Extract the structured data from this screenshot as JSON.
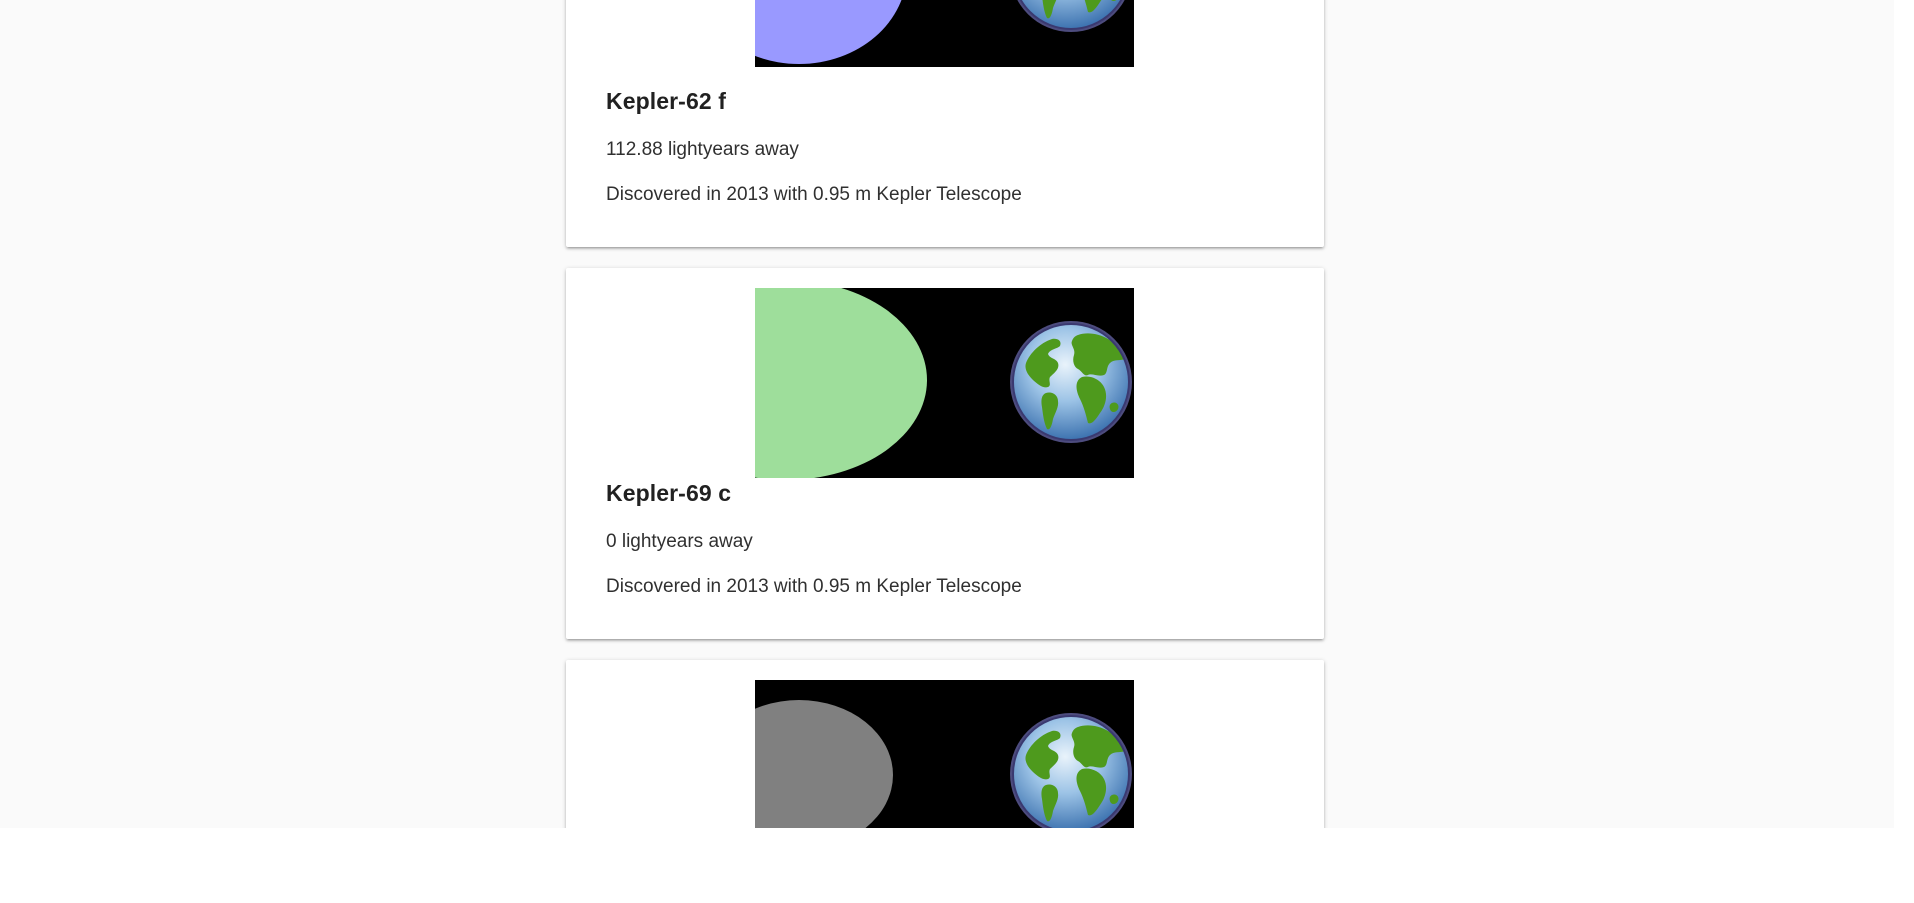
{
  "planets": [
    {
      "name": "Kepler-62 f",
      "distance_text": "112.88 lightyears away",
      "discovery_text": "Discovered in 2013 with 0.95 m Kepler Telescope",
      "color": "#9999ff",
      "comparison_icon": "earth-icon"
    },
    {
      "name": "Kepler-69 c",
      "distance_text": "0 lightyears away",
      "discovery_text": "Discovered in 2013 with 0.95 m Kepler Telescope",
      "color": "#9ede9b",
      "comparison_icon": "earth-icon"
    },
    {
      "color": "#808080",
      "comparison_icon": "earth-icon"
    }
  ],
  "colors": {
    "page_background": "#fafafa",
    "card_background": "#ffffff",
    "visualization_background": "#000000"
  }
}
